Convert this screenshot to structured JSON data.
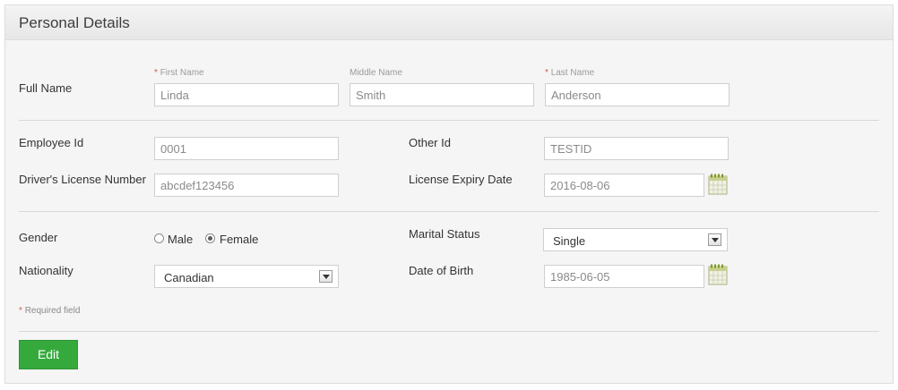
{
  "panel": {
    "title": "Personal Details"
  },
  "full_name": {
    "label": "Full Name",
    "first": {
      "required_mark": "*",
      "label": "First Name",
      "value": "Linda"
    },
    "middle": {
      "label": "Middle Name",
      "value": "Smith"
    },
    "last": {
      "required_mark": "*",
      "label": "Last Name",
      "value": "Anderson"
    }
  },
  "employee_id": {
    "label": "Employee Id",
    "value": "0001"
  },
  "other_id": {
    "label": "Other Id",
    "value": "TESTID"
  },
  "license_number": {
    "label": "Driver's License Number",
    "value": "abcdef123456"
  },
  "license_expiry": {
    "label": "License Expiry Date",
    "value": "2016-08-06",
    "icon": "calendar-icon"
  },
  "gender": {
    "label": "Gender",
    "options": [
      "Male",
      "Female"
    ],
    "selected": "Female"
  },
  "marital_status": {
    "label": "Marital Status",
    "selected": "Single"
  },
  "nationality": {
    "label": "Nationality",
    "selected": "Canadian"
  },
  "date_of_birth": {
    "label": "Date of Birth",
    "value": "1985-06-05",
    "icon": "calendar-icon"
  },
  "required_note": {
    "mark": "*",
    "text": "Required field"
  },
  "actions": {
    "edit_label": "Edit"
  },
  "colors": {
    "primary_button": "#36a93d",
    "required": "#d9534f"
  }
}
